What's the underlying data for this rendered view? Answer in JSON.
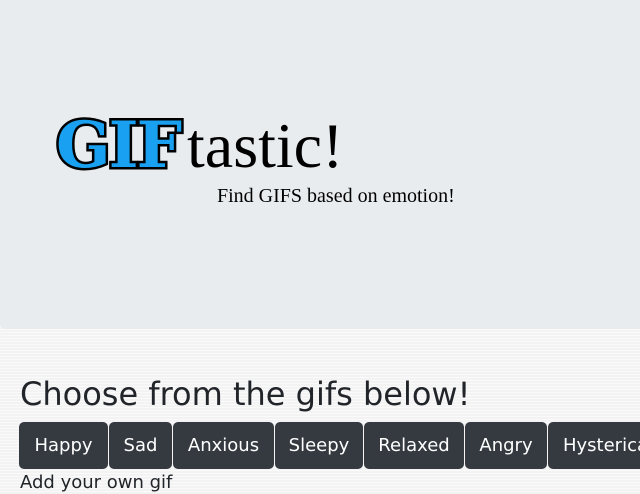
{
  "header": {
    "logo": {
      "gif": "GIF",
      "tastic": "tastic!"
    },
    "tagline": "Find GIFS based on emotion!"
  },
  "main": {
    "heading": "Choose from the gifs below!",
    "buttons": [
      {
        "label": "Happy"
      },
      {
        "label": "Sad"
      },
      {
        "label": "Anxious"
      },
      {
        "label": "Sleepy"
      },
      {
        "label": "Relaxed"
      },
      {
        "label": "Angry"
      },
      {
        "label": "Hysterical"
      }
    ],
    "below_text": "Add your own gif"
  },
  "colors": {
    "jumbotron_bg": "#e9ecef",
    "button_bg": "#343a40",
    "logo_accent": "#1aa0f0"
  }
}
